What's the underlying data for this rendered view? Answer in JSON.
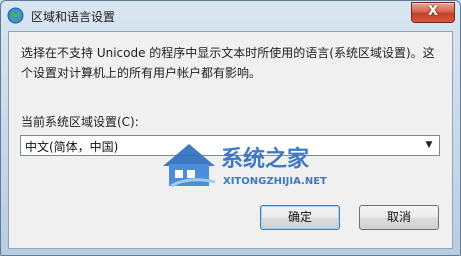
{
  "window": {
    "title": "区域和语言设置",
    "close_label": "X"
  },
  "description": "选择在不支持 Unicode 的程序中显示文本时所使用的语言(系统区域设置)。这个设置对计算机上的所有用户帐户都有影响。",
  "locale": {
    "label": "当前系统区域设置(C):",
    "selected_value": "中文(简体，中国)"
  },
  "buttons": {
    "ok_label": "确定",
    "cancel_label": "取消"
  },
  "watermark": {
    "brand": "系统之家",
    "url": "XITONGZHIJIA.NET"
  },
  "icons": {
    "title_icon": "globe-icon",
    "dropdown_icon": "chevron-down-icon",
    "close_icon": "close-icon",
    "logo_icon": "logo-icon"
  },
  "colors": {
    "close_button": "#c4412c",
    "watermark_blue": "#2f6fbf"
  }
}
